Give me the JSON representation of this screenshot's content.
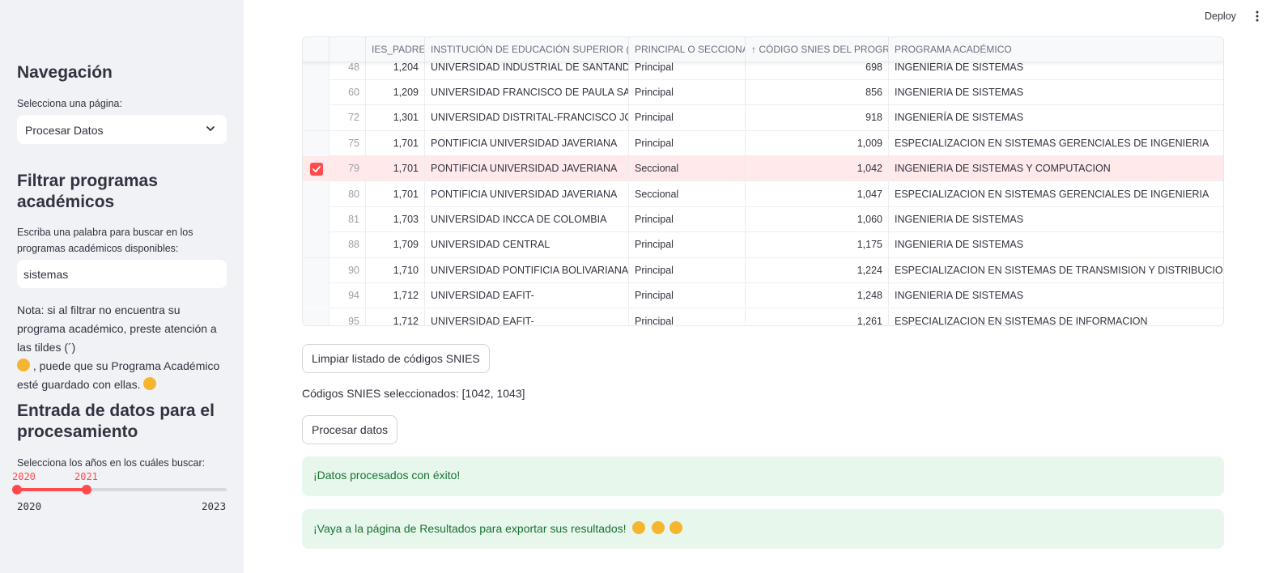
{
  "header": {
    "deploy_label": "Deploy",
    "menu_icon": "kebab-menu-icon"
  },
  "sidebar": {
    "nav_title": "Navegación",
    "page_select_label": "Selecciona una página:",
    "page_select_value": "Procesar Datos",
    "filter_title": "Filtrar programas académicos",
    "filter_label": "Escriba una palabra para buscar en los programas académicos disponibles:",
    "filter_value": "sistemas",
    "note_part1": "Nota: si al filtrar no encuentra su programa académico, preste atención a las tildes (´)",
    "note_part2": ", puede que su Programa Académico esté guardado con ellas.",
    "input_title": "Entrada de datos para el procesamiento",
    "years_label": "Selecciona los años en los cuáles buscar:",
    "slider": {
      "value_low": "2020",
      "value_high": "2021",
      "min": "2020",
      "max": "2023",
      "low_fraction": 0.0,
      "high_fraction": 0.333
    }
  },
  "table": {
    "columns": [
      "IES_PADRE",
      "INSTITUCIÓN DE EDUCACIÓN SUPERIOR (IES)",
      "PRINCIPAL O SECCIONAL",
      "↑ CÓDIGO SNIES DEL PROGRAMA",
      "PROGRAMA ACADÉMICO"
    ],
    "rows": [
      {
        "selected": false,
        "index": "48",
        "ies_padre": "1,204",
        "institucion": "UNIVERSIDAD INDUSTRIAL DE SANTANDER",
        "tipo": "Principal",
        "codigo": "698",
        "programa": "INGENIERIA DE SISTEMAS"
      },
      {
        "selected": false,
        "index": "60",
        "ies_padre": "1,209",
        "institucion": "UNIVERSIDAD FRANCISCO DE PAULA SANTANDER",
        "tipo": "Principal",
        "codigo": "856",
        "programa": "INGENIERIA DE SISTEMAS"
      },
      {
        "selected": false,
        "index": "72",
        "ies_padre": "1,301",
        "institucion": "UNIVERSIDAD DISTRITAL-FRANCISCO JOSE DE CALDAS",
        "tipo": "Principal",
        "codigo": "918",
        "programa": "INGENIERÍA DE SISTEMAS"
      },
      {
        "selected": false,
        "index": "75",
        "ies_padre": "1,701",
        "institucion": "PONTIFICIA UNIVERSIDAD JAVERIANA",
        "tipo": "Principal",
        "codigo": "1,009",
        "programa": "ESPECIALIZACION EN SISTEMAS GERENCIALES DE INGENIERIA"
      },
      {
        "selected": true,
        "index": "79",
        "ies_padre": "1,701",
        "institucion": "PONTIFICIA UNIVERSIDAD JAVERIANA",
        "tipo": "Seccional",
        "codigo": "1,042",
        "programa": "INGENIERIA DE SISTEMAS Y COMPUTACION"
      },
      {
        "selected": false,
        "index": "80",
        "ies_padre": "1,701",
        "institucion": "PONTIFICIA UNIVERSIDAD JAVERIANA",
        "tipo": "Seccional",
        "codigo": "1,047",
        "programa": "ESPECIALIZACION EN SISTEMAS GERENCIALES DE INGENIERIA"
      },
      {
        "selected": false,
        "index": "81",
        "ies_padre": "1,703",
        "institucion": "UNIVERSIDAD INCCA DE COLOMBIA",
        "tipo": "Principal",
        "codigo": "1,060",
        "programa": "INGENIERIA DE SISTEMAS"
      },
      {
        "selected": false,
        "index": "88",
        "ies_padre": "1,709",
        "institucion": "UNIVERSIDAD CENTRAL",
        "tipo": "Principal",
        "codigo": "1,175",
        "programa": "INGENIERIA DE SISTEMAS"
      },
      {
        "selected": false,
        "index": "90",
        "ies_padre": "1,710",
        "institucion": "UNIVERSIDAD PONTIFICIA BOLIVARIANA",
        "tipo": "Principal",
        "codigo": "1,224",
        "programa": "ESPECIALIZACION EN SISTEMAS DE TRANSMISION Y DISTRIBUCION DE ENERGIA"
      },
      {
        "selected": false,
        "index": "94",
        "ies_padre": "1,712",
        "institucion": "UNIVERSIDAD EAFIT-",
        "tipo": "Principal",
        "codigo": "1,248",
        "programa": "INGENIERIA DE SISTEMAS"
      },
      {
        "selected": false,
        "index": "95",
        "ies_padre": "1,712",
        "institucion": "UNIVERSIDAD EAFIT-",
        "tipo": "Principal",
        "codigo": "1,261",
        "programa": "ESPECIALIZACION EN SISTEMAS DE INFORMACION"
      }
    ]
  },
  "main": {
    "clear_button": "Limpiar listado de códigos SNIES",
    "selected_codes": "Códigos SNIES seleccionados: [1042, 1043]",
    "process_button": "Procesar datos",
    "success_message": "¡Datos procesados con éxito!",
    "results_message": "¡Vaya a la página de Resultados para exportar sus resultados!"
  },
  "colors": {
    "accent": "#ff4b4b",
    "sidebar_bg": "#f0f2f6",
    "success_bg": "#e8f7ec",
    "success_text": "#177233",
    "selected_row": "#ffe9ea"
  }
}
